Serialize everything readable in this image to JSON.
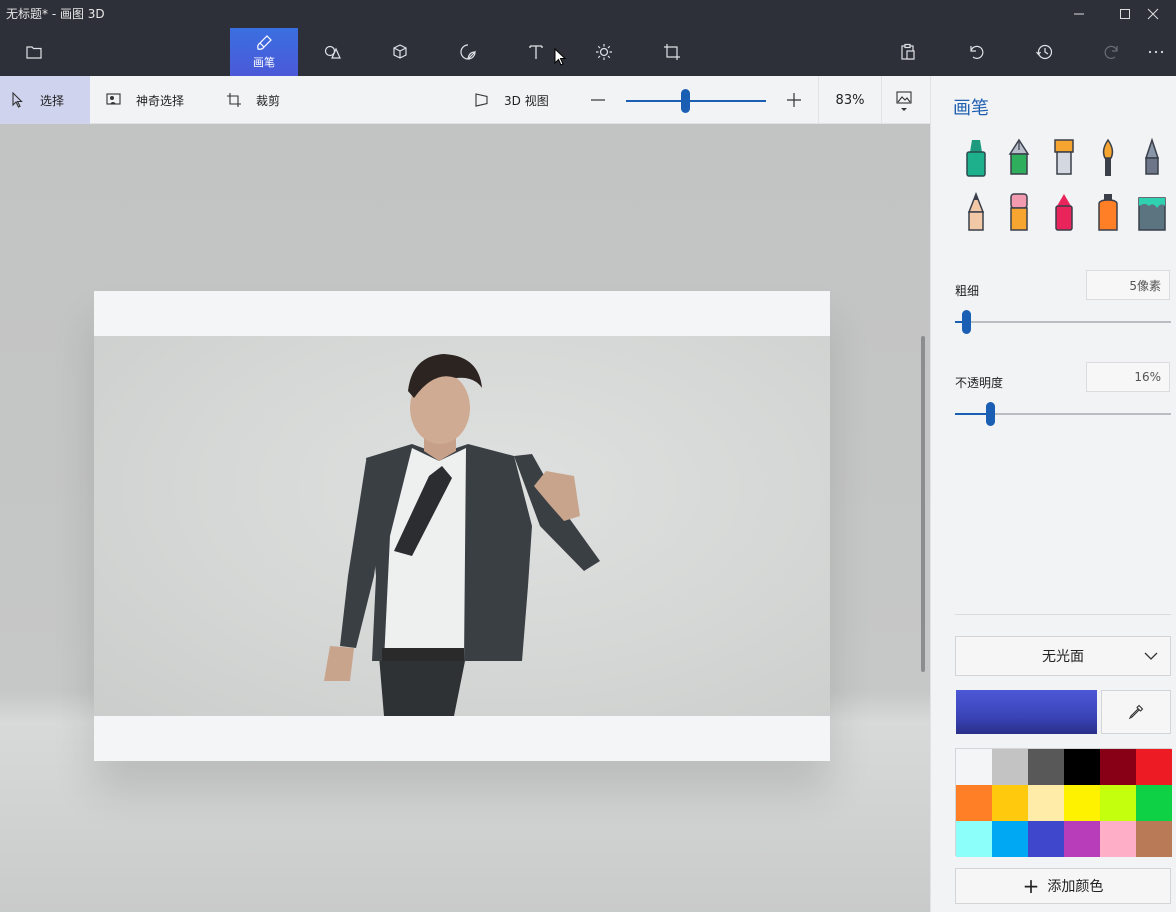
{
  "window": {
    "title": "无标题* - 画图 3D",
    "controls": [
      "minimize-icon",
      "maximize-icon",
      "close-icon"
    ]
  },
  "toolbar": {
    "menu_icon": "folder-icon",
    "tools": [
      {
        "id": "brushes",
        "label": "画笔",
        "icon": "brush-icon",
        "active": true
      },
      {
        "id": "2d-shapes",
        "label": "",
        "icon": "shapes-2d-icon"
      },
      {
        "id": "3d-shapes",
        "label": "",
        "icon": "cube-icon"
      },
      {
        "id": "stickers",
        "label": "",
        "icon": "sticker-icon"
      },
      {
        "id": "text",
        "label": "",
        "icon": "text-icon"
      },
      {
        "id": "effects",
        "label": "",
        "icon": "sun-icon"
      },
      {
        "id": "canvas",
        "label": "",
        "icon": "canvas-crop-icon"
      }
    ],
    "right_icons": [
      "paste-icon",
      "undo-icon",
      "history-icon",
      "redo-icon",
      "more-icon"
    ]
  },
  "subbar": {
    "select_label": "选择",
    "magic_select_label": "神奇选择",
    "crop_label": "裁剪",
    "view3d_label": "3D 视图",
    "zoom_percent": "83%",
    "zoom_level": 0.42
  },
  "panel": {
    "title": "画笔",
    "brushes": [
      "marker-icon",
      "calligraphy-pen-icon",
      "oil-brush-icon",
      "watercolor-icon",
      "pixel-pen-icon",
      "pencil-icon",
      "eraser-icon",
      "crayon-icon",
      "spray-can-icon",
      "fill-bucket-icon"
    ],
    "thickness_label": "粗细",
    "thickness_value": "5像素",
    "thickness_level": 0.05,
    "opacity_label": "不透明度",
    "opacity_value": "16%",
    "opacity_level": 0.16,
    "finish_value": "无光面",
    "current_color": "#4450c8",
    "palette": [
      "#f4f5f7",
      "#c3c3c3",
      "#585858",
      "#000000",
      "#880015",
      "#ed1c24",
      "#ff7f27",
      "#ffc90e",
      "#ffeca8",
      "#fff200",
      "#c4ff0e",
      "#0ed145",
      "#8cfffb",
      "#00a8f3",
      "#3f48cc",
      "#b83dba",
      "#ffaec8",
      "#b97a57"
    ],
    "add_color_label": "添加颜色"
  }
}
